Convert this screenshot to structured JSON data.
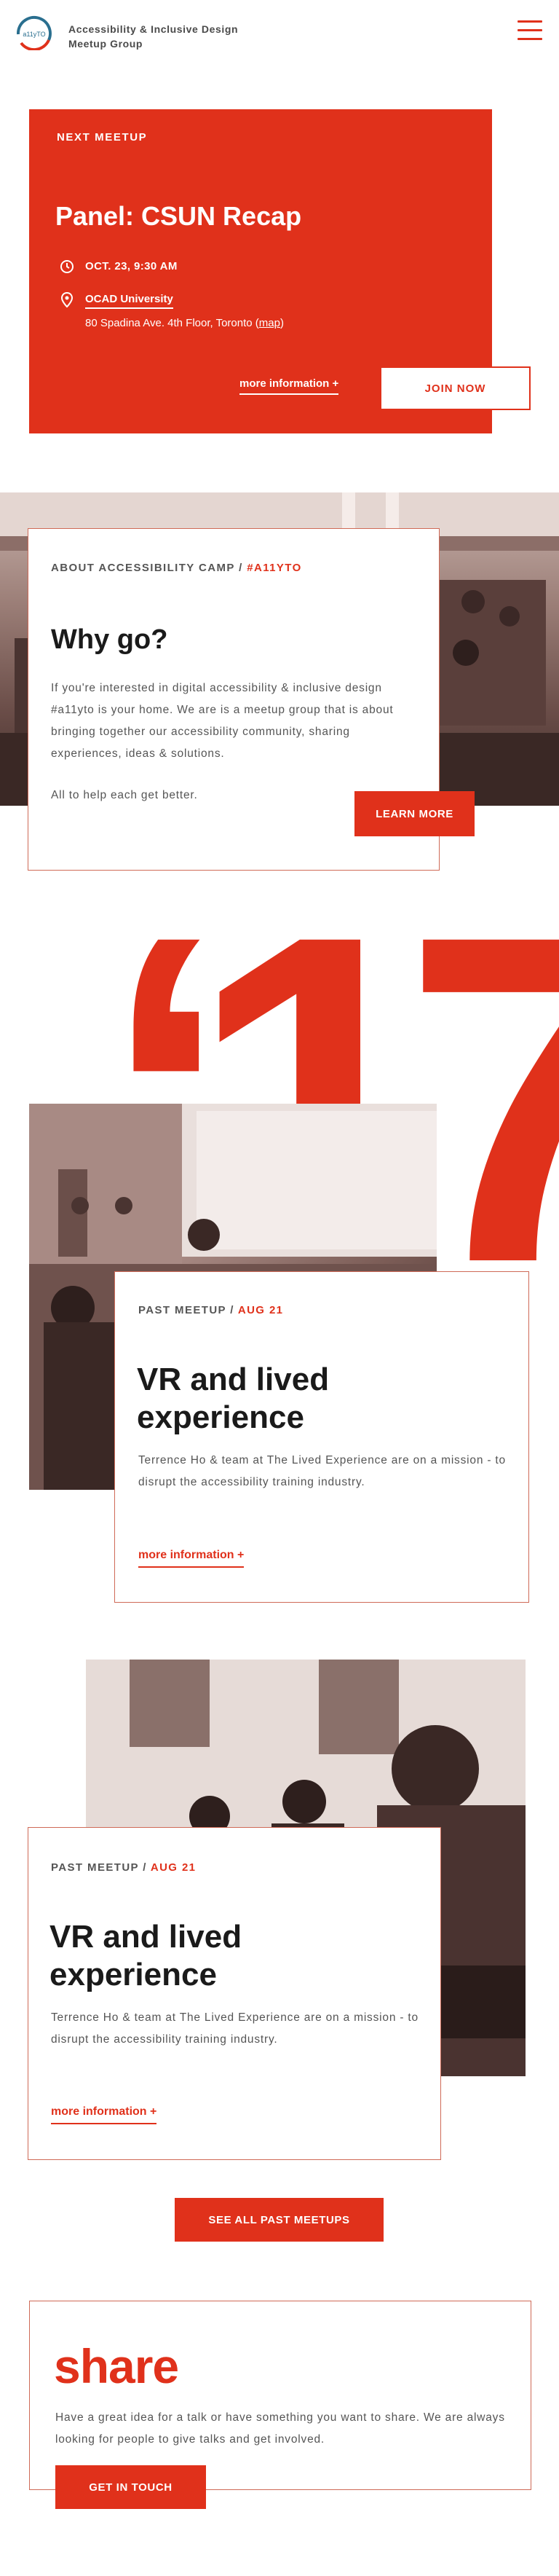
{
  "header": {
    "logo_text": "a11yTO",
    "title_line1": "Accessibility & Inclusive Design",
    "title_line2": "Meetup Group",
    "menu_icon": "hamburger-menu-icon"
  },
  "next_meetup": {
    "label": "NEXT MEETUP",
    "title": "Panel: CSUN Recap",
    "datetime": "OCT. 23, 9:30 AM",
    "venue": "OCAD University",
    "address_prefix": "80 Spadina Ave. 4th Floor, Toronto (",
    "map_link": "map",
    "address_suffix": ")",
    "more_info": "more information +",
    "join_button": "JOIN NOW",
    "icons": [
      "clock-icon",
      "location-pin-icon"
    ]
  },
  "about": {
    "label_main": "ABOUT ACCESSIBILITY CAMP /",
    "label_hash": "#A11YTO",
    "title": "Why go?",
    "body": "If you're interested in digital accessibility & inclusive design #a11yto is your home. We are is a meetup group that is about bringing together our accessibility community, sharing experiences, ideas & solutions.",
    "tagline": "All to help each get better.",
    "button": "LEARN MORE"
  },
  "year_graphic": "‘17",
  "past_meetups": [
    {
      "label": "PAST MEETUP /",
      "date": "AUG 21",
      "title": "VR and lived experience",
      "description": "Terrence Ho & team at The Lived Experience are on a mission - to disrupt the accessibility training industry.",
      "more_info": "more information +"
    },
    {
      "label": "PAST MEETUP /",
      "date": "AUG 21",
      "title": "VR and lived experience",
      "description": "Terrence Ho & team at The Lived Experience are on a mission - to disrupt the accessibility training industry.",
      "more_info": "more information +"
    }
  ],
  "see_all_button": "SEE ALL PAST MEETUPS",
  "share": {
    "title": "share",
    "body": "Have a great idea for a talk or have something you want to share. We are always looking for people to give talks and get involved.",
    "button": "GET IN TOUCH"
  },
  "colors": {
    "accent": "#e0311b",
    "text": "#555555",
    "heading": "#1a1a1a"
  }
}
